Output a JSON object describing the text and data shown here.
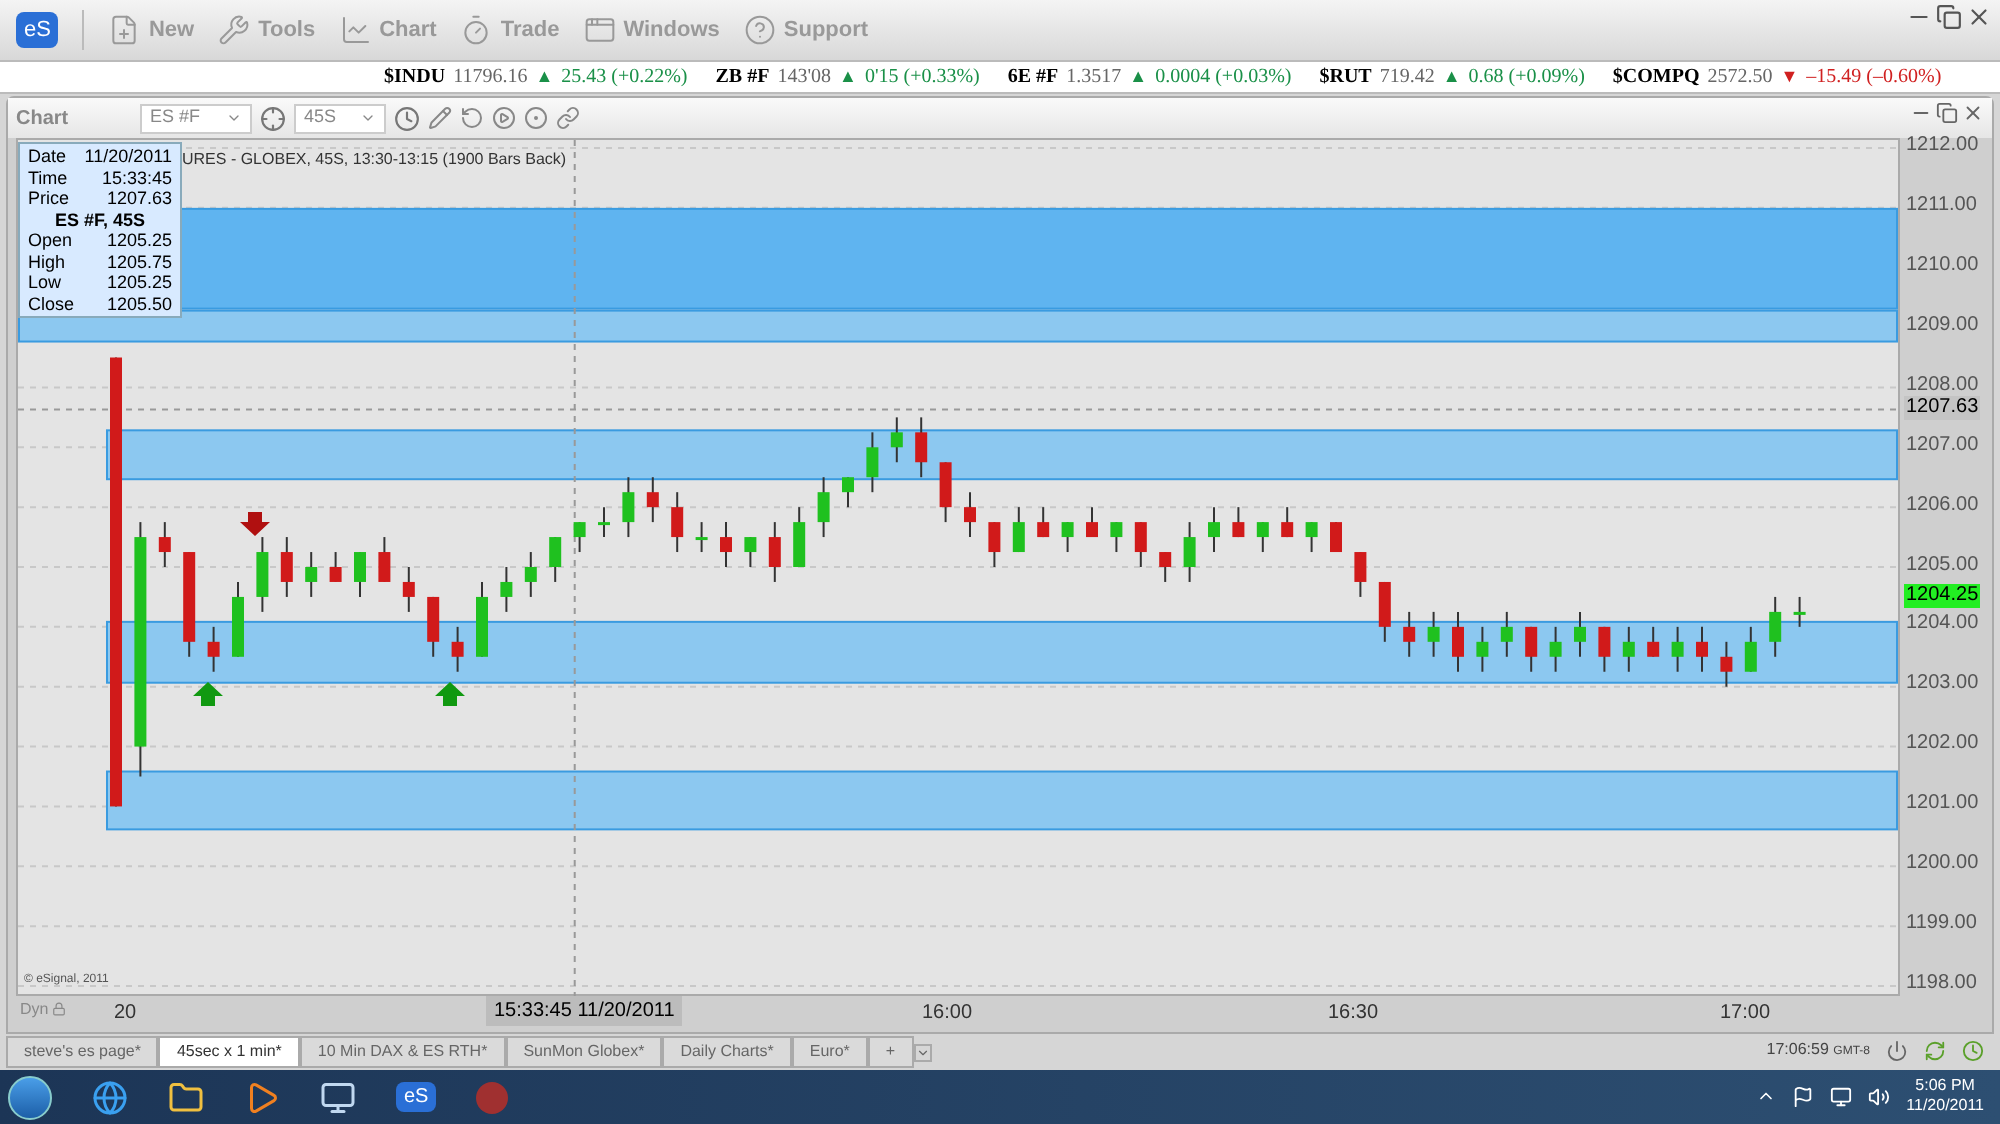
{
  "toolbar": {
    "logo": "eS",
    "items": [
      {
        "kind": "new",
        "label": "New"
      },
      {
        "kind": "tools",
        "label": "Tools"
      },
      {
        "kind": "chart",
        "label": "Chart"
      },
      {
        "kind": "trade",
        "label": "Trade"
      },
      {
        "kind": "windows",
        "label": "Windows"
      },
      {
        "kind": "support",
        "label": "Support"
      }
    ]
  },
  "ticker": [
    {
      "symbol": "$INDU",
      "last": "11796.16",
      "arrow": "▲",
      "change": "25.43 (+0.22%)",
      "negative": false
    },
    {
      "symbol": "ZB #F",
      "last": "143'08",
      "arrow": "▲",
      "change": "0'15 (+0.33%)",
      "negative": false
    },
    {
      "symbol": "6E #F",
      "last": "1.3517",
      "arrow": "▲",
      "change": "0.0004 (+0.03%)",
      "negative": false
    },
    {
      "symbol": "$RUT",
      "last": "719.42",
      "arrow": "▲",
      "change": "0.68 (+0.09%)",
      "negative": false
    },
    {
      "symbol": "$COMPQ",
      "last": "2572.50",
      "arrow": "▼",
      "change": "–15.49 (–0.60%)",
      "negative": true
    }
  ],
  "chart_window": {
    "title": "Chart",
    "symbol": "ES #F",
    "interval": "45S",
    "header": "URES - GLOBEX, 45S, 13:30-13:15 (1900 Bars Back)",
    "info": {
      "rows": [
        {
          "label": "Date",
          "value": "11/20/2011"
        },
        {
          "label": "Time",
          "value": "15:33:45"
        },
        {
          "label": "Price",
          "value": "1207.63"
        }
      ],
      "title": "ES #F, 45S",
      "ohlc": [
        {
          "label": "Open",
          "value": "1205.25"
        },
        {
          "label": "High",
          "value": "1205.75"
        },
        {
          "label": "Low",
          "value": "1205.25"
        },
        {
          "label": "Close",
          "value": "1205.50"
        }
      ]
    },
    "chart_data": {
      "type": "candlestick",
      "ylim": [
        1198,
        1212
      ],
      "grid": true,
      "bands": [
        {
          "axis": "y",
          "from": 1209.3,
          "to": 1211.0,
          "color": "#5fb4f0"
        },
        {
          "axis": "y",
          "from": 1208.75,
          "to": 1209.3,
          "color": "#8cc8f0"
        },
        {
          "axis": "y",
          "from": 1206.45,
          "to": 1207.3,
          "color": "#8cc8f0"
        },
        {
          "axis": "y",
          "from": 1203.05,
          "to": 1204.1,
          "color": "#8cc8f0"
        },
        {
          "axis": "y",
          "from": 1200.6,
          "to": 1201.6,
          "color": "#8cc8f0"
        }
      ],
      "ref_lines": [
        {
          "axis": "y",
          "value": 1207.63
        }
      ],
      "categories": [
        null,
        null,
        null,
        null,
        null,
        null,
        null,
        null,
        null,
        null,
        null,
        null,
        null,
        null,
        null,
        null,
        null,
        null,
        null,
        null,
        null,
        null,
        null,
        null,
        null,
        null,
        null,
        null,
        null,
        null,
        null,
        null,
        null,
        null,
        null,
        null,
        null,
        null,
        null,
        null,
        null,
        null,
        null,
        null,
        null,
        null,
        null,
        null,
        null,
        null,
        null,
        null,
        null,
        null,
        null,
        null,
        null,
        null,
        null,
        null,
        null,
        null,
        null,
        null,
        null,
        null,
        null,
        null,
        null,
        null
      ],
      "ohlc": [
        [
          1208.5,
          1208.5,
          1201,
          1201
        ],
        [
          1202,
          1205.75,
          1201.5,
          1205.5
        ],
        [
          1205.5,
          1205.75,
          1205,
          1205.25
        ],
        [
          1205.25,
          1205.25,
          1203.5,
          1203.75
        ],
        [
          1203.75,
          1204,
          1203.25,
          1203.5
        ],
        [
          1203.5,
          1204.75,
          1203.5,
          1204.5
        ],
        [
          1204.5,
          1205.5,
          1204.25,
          1205.25
        ],
        [
          1205.25,
          1205.5,
          1204.5,
          1204.75
        ],
        [
          1204.75,
          1205.25,
          1204.5,
          1205
        ],
        [
          1205,
          1205.25,
          1204.75,
          1204.75
        ],
        [
          1204.75,
          1205.25,
          1204.5,
          1205.25
        ],
        [
          1205.25,
          1205.5,
          1204.75,
          1204.75
        ],
        [
          1204.75,
          1205,
          1204.25,
          1204.5
        ],
        [
          1204.5,
          1204.5,
          1203.5,
          1203.75
        ],
        [
          1203.75,
          1204,
          1203.25,
          1203.5
        ],
        [
          1203.5,
          1204.75,
          1203.5,
          1204.5
        ],
        [
          1204.5,
          1205,
          1204.25,
          1204.75
        ],
        [
          1204.75,
          1205.25,
          1204.5,
          1205
        ],
        [
          1205,
          1205.5,
          1204.75,
          1205.5
        ],
        [
          1205.5,
          1205.75,
          1205.25,
          1205.75
        ],
        [
          1205.75,
          1206,
          1205.5,
          1205.75
        ],
        [
          1205.75,
          1206.5,
          1205.5,
          1206.25
        ],
        [
          1206.25,
          1206.5,
          1205.75,
          1206
        ],
        [
          1206,
          1206.25,
          1205.25,
          1205.5
        ],
        [
          1205.5,
          1205.75,
          1205.25,
          1205.5
        ],
        [
          1205.5,
          1205.75,
          1205,
          1205.25
        ],
        [
          1205.25,
          1205.5,
          1205,
          1205.5
        ],
        [
          1205.5,
          1205.75,
          1204.75,
          1205
        ],
        [
          1205,
          1206,
          1205,
          1205.75
        ],
        [
          1205.75,
          1206.5,
          1205.5,
          1206.25
        ],
        [
          1206.25,
          1206.5,
          1206,
          1206.5
        ],
        [
          1206.5,
          1207.25,
          1206.25,
          1207
        ],
        [
          1207,
          1207.5,
          1206.75,
          1207.25
        ],
        [
          1207.25,
          1207.5,
          1206.5,
          1206.75
        ],
        [
          1206.75,
          1206.75,
          1205.75,
          1206
        ],
        [
          1206,
          1206.25,
          1205.5,
          1205.75
        ],
        [
          1205.75,
          1205.75,
          1205,
          1205.25
        ],
        [
          1205.25,
          1206,
          1205.25,
          1205.75
        ],
        [
          1205.75,
          1206,
          1205.5,
          1205.5
        ],
        [
          1205.5,
          1205.75,
          1205.25,
          1205.75
        ],
        [
          1205.75,
          1206,
          1205.5,
          1205.5
        ],
        [
          1205.5,
          1205.75,
          1205.25,
          1205.75
        ],
        [
          1205.75,
          1205.75,
          1205,
          1205.25
        ],
        [
          1205.25,
          1205.25,
          1204.75,
          1205
        ],
        [
          1205,
          1205.75,
          1204.75,
          1205.5
        ],
        [
          1205.5,
          1206,
          1205.25,
          1205.75
        ],
        [
          1205.75,
          1206,
          1205.5,
          1205.5
        ],
        [
          1205.5,
          1205.75,
          1205.25,
          1205.75
        ],
        [
          1205.75,
          1206,
          1205.5,
          1205.5
        ],
        [
          1205.5,
          1205.75,
          1205.25,
          1205.75
        ],
        [
          1205.75,
          1205.75,
          1205.25,
          1205.25
        ],
        [
          1205.25,
          1205.25,
          1204.5,
          1204.75
        ],
        [
          1204.75,
          1204.75,
          1203.75,
          1204
        ],
        [
          1204,
          1204.25,
          1203.5,
          1203.75
        ],
        [
          1203.75,
          1204.25,
          1203.5,
          1204
        ],
        [
          1204,
          1204.25,
          1203.25,
          1203.5
        ],
        [
          1203.5,
          1204,
          1203.25,
          1203.75
        ],
        [
          1203.75,
          1204.25,
          1203.5,
          1204
        ],
        [
          1204,
          1204,
          1203.25,
          1203.5
        ],
        [
          1203.5,
          1204,
          1203.25,
          1203.75
        ],
        [
          1203.75,
          1204.25,
          1203.5,
          1204
        ],
        [
          1204,
          1204,
          1203.25,
          1203.5
        ],
        [
          1203.5,
          1204,
          1203.25,
          1203.75
        ],
        [
          1203.75,
          1204,
          1203.5,
          1203.5
        ],
        [
          1203.5,
          1204,
          1203.25,
          1203.75
        ],
        [
          1203.75,
          1204,
          1203.25,
          1203.5
        ],
        [
          1203.5,
          1203.75,
          1203,
          1203.25
        ],
        [
          1203.25,
          1204,
          1203.25,
          1203.75
        ],
        [
          1203.75,
          1204.5,
          1203.5,
          1204.25
        ],
        [
          1204.25,
          1204.5,
          1204,
          1204.25
        ]
      ],
      "yticks": [
        {
          "value": 1212,
          "label": "1212.00"
        },
        {
          "value": 1211,
          "label": "1211.00"
        },
        {
          "value": 1210,
          "label": "1210.00"
        },
        {
          "value": 1209,
          "label": "1209.00"
        },
        {
          "value": 1208,
          "label": "1208.00"
        },
        {
          "value": 1207,
          "label": "1207.00"
        },
        {
          "value": 1206,
          "label": "1206.00"
        },
        {
          "value": 1205,
          "label": "1205.00"
        },
        {
          "value": 1204,
          "label": "1204.00"
        },
        {
          "value": 1203,
          "label": "1203.00"
        },
        {
          "value": 1202,
          "label": "1202.00"
        },
        {
          "value": 1201,
          "label": "1201.00"
        },
        {
          "value": 1200,
          "label": "1200.00"
        },
        {
          "value": 1199,
          "label": "1199.00"
        },
        {
          "value": 1198,
          "label": "1198.00"
        }
      ]
    },
    "time_ticks": [
      "20",
      "16:00",
      "16:30",
      "17:00"
    ],
    "price_labels": [
      {
        "kind": "cursor",
        "text": "1207.63"
      },
      {
        "kind": "last",
        "text": "1204.25"
      }
    ],
    "cursor_time": "15:33:45 11/20/2011",
    "copyright": "© eSignal, 2011",
    "dyn": "Dyn"
  },
  "tabs": [
    {
      "label": "steve's es page*",
      "selected": false
    },
    {
      "label": "45sec x 1 min*",
      "selected": true
    },
    {
      "label": "10 Min DAX & ES RTH*",
      "selected": false
    },
    {
      "label": "SunMon Globex*",
      "selected": false
    },
    {
      "label": "Daily Charts*",
      "selected": false
    },
    {
      "label": "Euro*",
      "selected": false
    },
    {
      "label": "+",
      "selected": false
    }
  ],
  "status": {
    "time": "17:06:59",
    "zone": "GMT-8"
  },
  "taskbar": {
    "app_logo": "eS",
    "time": "5:06 PM",
    "date": "11/20/2011"
  }
}
